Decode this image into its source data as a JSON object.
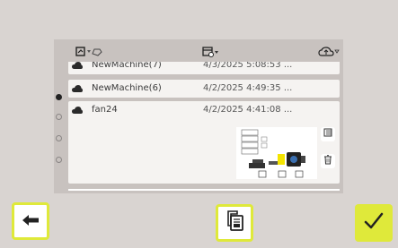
{
  "list": {
    "items": [
      {
        "name": "NewMachine(7)",
        "date": "4/3/2025 5:08:53 ..."
      },
      {
        "name": "NewMachine(6)",
        "date": "4/2/2025 4:49:35 ..."
      },
      {
        "name": "fan24",
        "date": "4/2/2025 4:41:08 ..."
      }
    ]
  },
  "pagination": {
    "dots": 4,
    "active_index": 0
  },
  "colors": {
    "accent": "#dfe93a",
    "background": "#d9d4d1",
    "panel": "#c8c2bf",
    "row": "#f5f3f1"
  },
  "icons": {
    "header": [
      "machine-filter-icon",
      "sort-tag-icon",
      "calendar-sort-icon",
      "cloud-sort-icon"
    ],
    "row": "cloud-icon",
    "expanded": [
      "fingerprint-icon",
      "trash-icon"
    ],
    "bottom": [
      "arrow-left-icon",
      "duplicate-document-icon",
      "checkmark-icon"
    ]
  }
}
